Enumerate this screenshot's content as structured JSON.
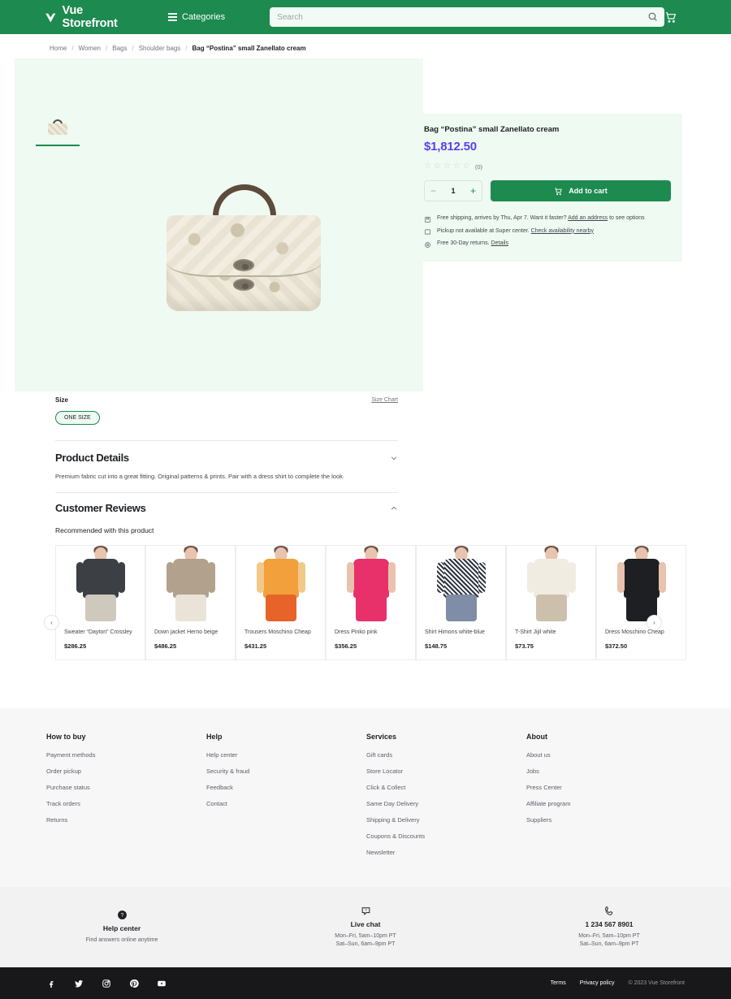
{
  "header": {
    "logo_text": "Vue Storefront",
    "categories_label": "Categories",
    "search_placeholder": "Search",
    "search_value": "",
    "accent_color": "#1d8a4f"
  },
  "breadcrumb": [
    {
      "label": "Home"
    },
    {
      "label": "Women"
    },
    {
      "label": "Bags"
    },
    {
      "label": "Shoulder bags"
    },
    {
      "label": "Bag “Postina” small Zanellato cream"
    }
  ],
  "product": {
    "title": "Bag “Postina” small Zanellato cream",
    "price": "$1,812.50",
    "price_color": "#5a3ff0",
    "rating_stars": 0,
    "rating_count": "(0)",
    "quantity": "1",
    "add_to_cart_label": "Add to cart",
    "shipping": [
      {
        "icon": "shipping-box-icon",
        "text": "Free shipping, arrives by Thu, Apr 7. Want it faster?",
        "link": "Add an address",
        "text_after": "to see options"
      },
      {
        "icon": "store-pickup-icon",
        "text": "Pickup not available at Super center.",
        "link": "Check availability nearby",
        "text_after": ""
      },
      {
        "icon": "returns-icon",
        "text": "Free 30-Day returns.",
        "link": "Details",
        "text_after": ""
      }
    ],
    "size_label": "Size",
    "size_chart_label": "Size Chart",
    "size_option": "ONE SIZE"
  },
  "accordions": [
    {
      "title": "Product Details",
      "body": "Premium fabric cut into a great fitting. Original patterns & prints. Pair with a dress shirt to complete the look.",
      "chevron": "chevron-down-icon"
    },
    {
      "title": "Customer Reviews",
      "body": "",
      "chevron": "chevron-up-icon"
    }
  ],
  "recommended": {
    "title": "Recommended with this product",
    "prev_label": "‹",
    "next_label": "›",
    "cards": [
      {
        "name": "Sweater “Dayton” Crossley",
        "price": "$286.25",
        "top": "#3c4045",
        "bottom": "#cfc8bc",
        "arms": "#3c4045"
      },
      {
        "name": "Down jacket Herno beige",
        "price": "$486.25",
        "top": "#b2a18c",
        "bottom": "#eae4d8",
        "arms": "#b2a18c"
      },
      {
        "name": "Trousers Moschino Cheap",
        "price": "$431.25",
        "top": "#f2a03c",
        "bottom": "#e8632a",
        "arms": "#f2c98a"
      },
      {
        "name": "Dress Pinko pink",
        "price": "$356.25",
        "top": "#e8316b",
        "bottom": "#e8316b",
        "arms": "#e8c3ad"
      },
      {
        "name": "Shirt Himons white-blue",
        "price": "$148.75",
        "top": "#dcdde2",
        "bottom": "#7f8da6",
        "arms": "#dcdde2"
      },
      {
        "name": "T-Shirt Jijil white",
        "price": "$73.75",
        "top": "#f1ece2",
        "bottom": "#ccc0ac",
        "arms": "#f1ece2"
      },
      {
        "name": "Dress Moschino Cheap",
        "price": "$372.50",
        "top": "#1d1f22",
        "bottom": "#1d1f22",
        "arms": "#e8c3ad"
      }
    ]
  },
  "footer": {
    "columns": [
      {
        "heading": "How to buy",
        "links": [
          "Payment methods",
          "Order pickup",
          "Purchase status",
          "Track orders",
          "Returns"
        ]
      },
      {
        "heading": "Help",
        "links": [
          "Help center",
          "Security & fraud",
          "Feedback",
          "Contact"
        ]
      },
      {
        "heading": "Services",
        "links": [
          "Gift cards",
          "Store Locator",
          "Click & Collect",
          "Same Day Delivery",
          "Shipping & Delivery",
          "Coupons & Discounts",
          "Newsletter"
        ]
      },
      {
        "heading": "About",
        "links": [
          "About us",
          "Jobs",
          "Press Center",
          "Affiliate program",
          "Suppliers"
        ]
      }
    ],
    "contact": [
      {
        "icon": "help-circle-icon",
        "title": "Help center",
        "sub1": "Find answers online anytime",
        "sub2": ""
      },
      {
        "icon": "chat-icon",
        "title": "Live chat",
        "sub1": "Mon–Fri, 5am–10pm PT",
        "sub2": "Sat–Sun, 6am–9pm PT"
      },
      {
        "icon": "phone-icon",
        "title": "1 234 567 8901",
        "sub1": "Mon–Fri, 5am–10pm PT",
        "sub2": "Sat–Sun, 6am–9pm PT"
      }
    ],
    "socials": [
      "facebook-icon",
      "twitter-icon",
      "instagram-icon",
      "pinterest-icon",
      "youtube-icon"
    ],
    "terms_label": "Terms",
    "privacy_label": "Privacy policy",
    "copyright": "© 2023 Vue Storefront"
  }
}
